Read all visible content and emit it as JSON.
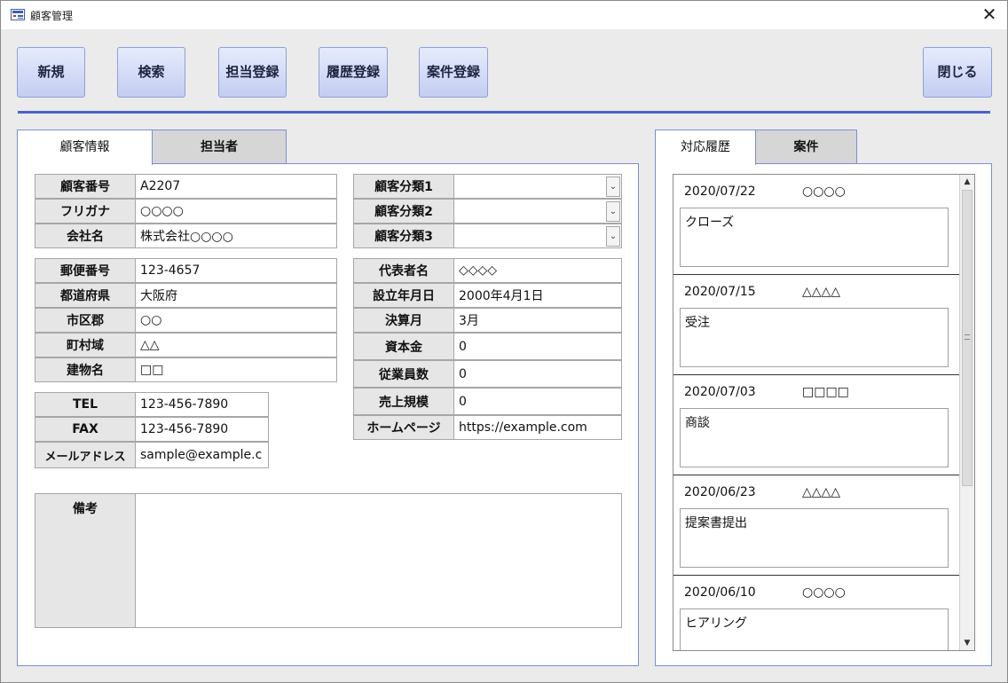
{
  "window": {
    "title": "顧客管理",
    "close_glyph": "✕"
  },
  "toolbar": {
    "new_label": "新規",
    "search_label": "検索",
    "staff_register_label": "担当登録",
    "history_register_label": "履歴登録",
    "case_register_label": "案件登録",
    "close_label": "閉じる"
  },
  "left_tabs": {
    "customer_info": "顧客情報",
    "contact_person": "担当者"
  },
  "basic": {
    "customer_no_label": "顧客番号",
    "customer_no": "A2207",
    "furigana_label": "フリガナ",
    "furigana": "○○○○",
    "company_label": "会社名",
    "company": "株式会社○○○○"
  },
  "category": {
    "cat1_label": "顧客分類1",
    "cat1": "",
    "cat2_label": "顧客分類2",
    "cat2": "",
    "cat3_label": "顧客分類3",
    "cat3": ""
  },
  "address": {
    "postal_label": "郵便番号",
    "postal": "123-4657",
    "prefecture_label": "都道府県",
    "prefecture": "大阪府",
    "city_label": "市区郡",
    "city": "○○",
    "town_label": "町村域",
    "town": "△△",
    "building_label": "建物名",
    "building": "□□"
  },
  "company": {
    "rep_label": "代表者名",
    "rep": "◇◇◇◇",
    "founded_label": "設立年月日",
    "founded": "2000年4月1日",
    "fiscal_label": "決算月",
    "fiscal": "3月",
    "capital_label": "資本金",
    "capital": "0",
    "employees_label": "従業員数",
    "employees": "0",
    "sales_label": "売上規模",
    "sales": "0",
    "homepage_label": "ホームページ",
    "homepage": "https://example.com"
  },
  "contact": {
    "tel_label": "TEL",
    "tel": "123-456-7890",
    "fax_label": "FAX",
    "fax": "123-456-7890",
    "email_label": "メールアドレス",
    "email": "sample@example.c"
  },
  "notes": {
    "label": "備考",
    "value": ""
  },
  "right_tabs": {
    "history": "対応履歴",
    "cases": "案件"
  },
  "history": [
    {
      "date": "2020/07/22",
      "person": "○○○○",
      "note": "クローズ"
    },
    {
      "date": "2020/07/15",
      "person": "△△△△",
      "note": "受注"
    },
    {
      "date": "2020/07/03",
      "person": "□□□□",
      "note": "商談"
    },
    {
      "date": "2020/06/23",
      "person": "△△△△",
      "note": "提案書提出"
    },
    {
      "date": "2020/06/10",
      "person": "○○○○",
      "note": "ヒアリング"
    }
  ],
  "colors": {
    "accent": "#4a64c8",
    "button_top": "#e6ebfb",
    "button_bottom": "#c4cdf2",
    "label_bg": "#e6e6e6"
  }
}
